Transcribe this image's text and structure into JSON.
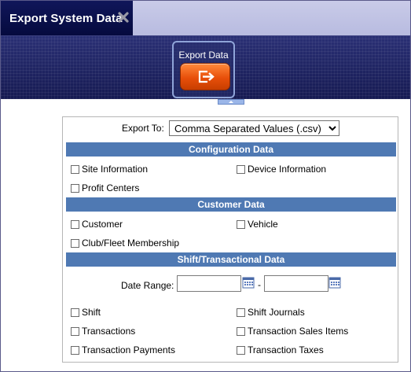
{
  "tab": {
    "title": "Export System Data"
  },
  "toolbar": {
    "export_label": "Export Data"
  },
  "export": {
    "label": "Export To:",
    "format_selected": "Comma Separated Values (.csv)"
  },
  "sections": {
    "config": {
      "header": "Configuration Data",
      "site": "Site Information",
      "device": "Device Information",
      "profit": "Profit Centers"
    },
    "customer": {
      "header": "Customer Data",
      "customer": "Customer",
      "vehicle": "Vehicle",
      "club": "Club/Fleet Membership"
    },
    "shift": {
      "header": "Shift/Transactional Data",
      "date_label": "Date Range:",
      "date_sep": "-",
      "shift": "Shift",
      "journals": "Shift Journals",
      "transactions": "Transactions",
      "sales_items": "Transaction Sales Items",
      "payments": "Transaction Payments",
      "taxes": "Transaction Taxes"
    }
  },
  "colors": {
    "section_header": "#4f79b3",
    "tab_bg": "#0a0f4a",
    "export_button": "#e8550f"
  },
  "icons": [
    "close-icon",
    "export-icon",
    "calendar-icon",
    "chevron-up-icon"
  ]
}
